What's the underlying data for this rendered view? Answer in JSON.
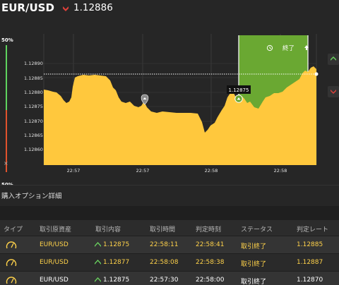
{
  "header": {
    "pair": "EUR/USD",
    "direction_icon": "down-arrow-icon",
    "price": "1.12886"
  },
  "strength": {
    "top_label": "50%",
    "bottom_label": "50%",
    "close_label": "×",
    "up_color": "#5fd35f",
    "down_color": "#e0522d"
  },
  "chart": {
    "end_label": "終了",
    "entry_tag": "1.12875",
    "y_ticks": [
      "1.12890",
      "1.12885",
      "1.12880",
      "1.12875",
      "1.12870",
      "1.12865",
      "1.12860"
    ],
    "x_ticks": [
      "22:57",
      "22:57",
      "22:58",
      "22:58"
    ],
    "area_color": "#ffc83d",
    "expiry_zone_color": "#6aa832"
  },
  "details": {
    "title": "購入オプション詳細",
    "columns": [
      "タイプ",
      "取引原資産",
      "取引内容",
      "取引時間",
      "判定時刻",
      "ステータス",
      "判定レート"
    ],
    "rows": [
      {
        "asset": "EUR/USD",
        "rate": "1.12875",
        "time": "22:58:11",
        "judge_time": "22:58:41",
        "status": "取引終了",
        "judge_rate": "1.12885"
      },
      {
        "asset": "EUR/USD",
        "rate": "1.12877",
        "time": "22:58:08",
        "judge_time": "22:58:38",
        "status": "取引終了",
        "judge_rate": "1.12887"
      },
      {
        "asset": "EUR/USD",
        "rate": "1.12875",
        "time": "22:57:30",
        "judge_time": "22:58:00",
        "status": "取引終了",
        "judge_rate": "1.12870"
      }
    ]
  }
}
